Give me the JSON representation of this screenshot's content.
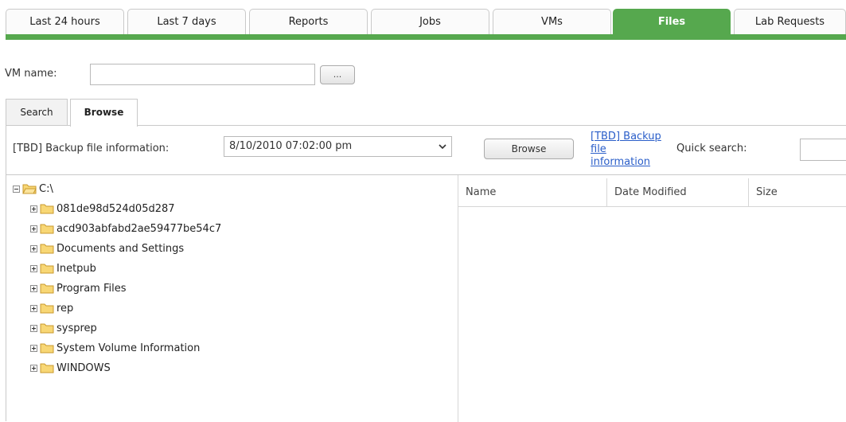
{
  "top_tabs": [
    {
      "label": "Last 24 hours"
    },
    {
      "label": "Last 7 days"
    },
    {
      "label": "Reports"
    },
    {
      "label": "Jobs"
    },
    {
      "label": "VMs"
    },
    {
      "label": "Files",
      "active": true
    },
    {
      "label": "Lab Requests"
    }
  ],
  "accent_color": "#56a84e",
  "vm": {
    "label": "VM name:",
    "value": "",
    "picker_label": "..."
  },
  "sub_tabs": [
    {
      "label": "Search"
    },
    {
      "label": "Browse",
      "active": true
    }
  ],
  "toolbar": {
    "backup_label": "[TBD] Backup file information:",
    "backup_selected": "8/10/2010 07:02:00 pm",
    "browse_label": "Browse",
    "info_link": "[TBD] Backup file information",
    "quick_search_label": "Quick search:",
    "quick_search_value": ""
  },
  "tree": {
    "root": "C:\\",
    "items": [
      "081de98d524d05d287",
      "acd903abfabd2ae59477be54c7",
      "Documents and Settings",
      "Inetpub",
      "Program Files",
      "rep",
      "sysprep",
      "System Volume Information",
      "WINDOWS"
    ]
  },
  "file_list": {
    "columns": [
      "Name",
      "Date Modified",
      "Size"
    ],
    "rows": []
  }
}
